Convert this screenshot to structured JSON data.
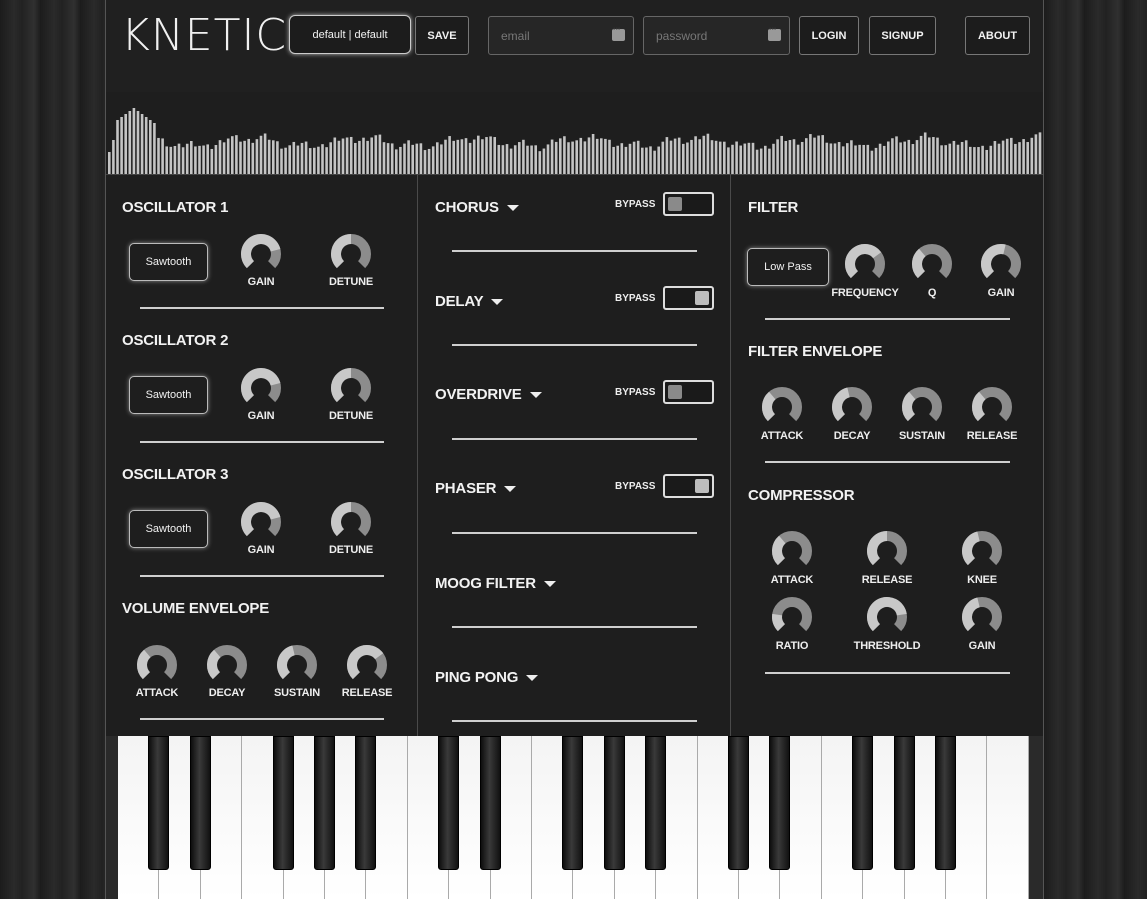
{
  "app": {
    "logo": "KNETIC",
    "preset_label": "default | default",
    "save_label": "SAVE",
    "email_placeholder": "email",
    "password_placeholder": "password",
    "login_label": "LOGIN",
    "signup_label": "SIGNUP",
    "about_label": "ABOUT"
  },
  "oscillators": [
    {
      "title": "OSCILLATOR 1",
      "waveform": "Sawtooth",
      "gain_label": "GAIN",
      "detune_label": "DETUNE"
    },
    {
      "title": "OSCILLATOR 2",
      "waveform": "Sawtooth",
      "gain_label": "GAIN",
      "detune_label": "DETUNE"
    },
    {
      "title": "OSCILLATOR 3",
      "waveform": "Sawtooth",
      "gain_label": "GAIN",
      "detune_label": "DETUNE"
    }
  ],
  "volume_envelope": {
    "title": "VOLUME ENVELOPE",
    "labels": [
      "ATTACK",
      "DECAY",
      "SUSTAIN",
      "RELEASE"
    ]
  },
  "effects": {
    "chorus": "CHORUS",
    "delay": "DELAY",
    "overdrive": "OVERDRIVE",
    "phaser": "PHASER",
    "moog": "MOOG FILTER",
    "pingpong": "PING PONG",
    "bypass": "BYPASS"
  },
  "filter": {
    "title": "FILTER",
    "type": "Low Pass",
    "labels": [
      "FREQUENCY",
      "Q",
      "GAIN"
    ]
  },
  "filter_envelope": {
    "title": "FILTER ENVELOPE",
    "labels": [
      "ATTACK",
      "DECAY",
      "SUSTAIN",
      "RELEASE"
    ]
  },
  "compressor": {
    "title": "COMPRESSOR",
    "labels": [
      "ATTACK",
      "RELEASE",
      "KNEE",
      "RATIO",
      "THRESHOLD",
      "GAIN"
    ]
  },
  "colors": {
    "knob_track": "#8c8c8c",
    "knob_fill": "#c8c8c8",
    "panel_bg": "#1e1e1e"
  }
}
